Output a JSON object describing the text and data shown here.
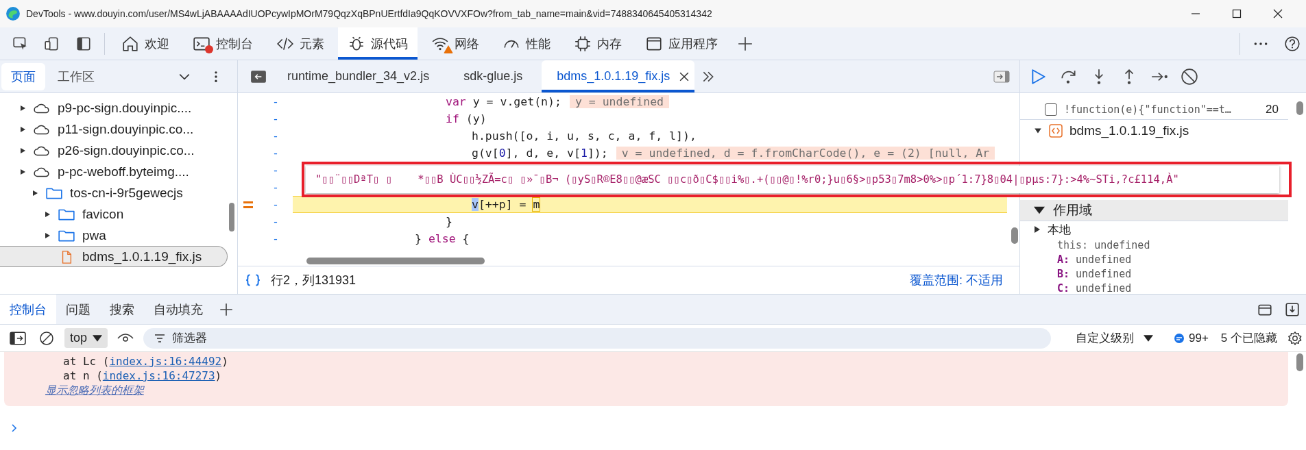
{
  "window": {
    "title": "DevTools - www.douyin.com/user/MS4wLjABAAAAdIUOPcywIpMOrM79QqzXqBPnUErtfdIa9QqKOVVXFOw?from_tab_name=main&vid=7488340645405314342"
  },
  "panel_tabs": [
    {
      "label": "欢迎",
      "selected": false,
      "error_badge": false,
      "warning_badge": false
    },
    {
      "label": "控制台",
      "selected": false,
      "error_badge": true,
      "warning_badge": false
    },
    {
      "label": "元素",
      "selected": false,
      "error_badge": false,
      "warning_badge": false
    },
    {
      "label": "源代码",
      "selected": true,
      "error_badge": false,
      "warning_badge": false
    },
    {
      "label": "网络",
      "selected": false,
      "error_badge": false,
      "warning_badge": true
    },
    {
      "label": "性能",
      "selected": false,
      "error_badge": false,
      "warning_badge": false
    },
    {
      "label": "内存",
      "selected": false,
      "error_badge": false,
      "warning_badge": false
    },
    {
      "label": "应用程序",
      "selected": false,
      "error_badge": false,
      "warning_badge": false
    }
  ],
  "navigator": {
    "tabs": [
      {
        "label": "页面",
        "selected": true
      },
      {
        "label": "工作区",
        "selected": false
      }
    ],
    "tree": [
      {
        "label": "p9-pc-sign.douyinpic....",
        "kind": "domain",
        "selected": false
      },
      {
        "label": "p11-sign.douyinpic.co...",
        "kind": "domain",
        "selected": false
      },
      {
        "label": "p26-sign.douyinpic.co...",
        "kind": "domain",
        "selected": false
      },
      {
        "label": "p-pc-weboff.byteimg....",
        "kind": "domain",
        "selected": false,
        "children": [
          {
            "label": "tos-cn-i-9r5gewecjs",
            "kind": "folder",
            "selected": false,
            "children": [
              {
                "label": "favicon",
                "kind": "folder",
                "selected": false
              },
              {
                "label": "pwa",
                "kind": "folder",
                "selected": false
              },
              {
                "label": "bdms_1.0.1.19_fix.js",
                "kind": "file",
                "selected": true
              }
            ]
          }
        ]
      }
    ]
  },
  "editor": {
    "tabs": [
      {
        "label": "runtime_bundler_34_v2.js",
        "selected": false,
        "closable": false
      },
      {
        "label": "sdk-glue.js",
        "selected": false,
        "closable": false
      },
      {
        "label": "bdms_1.0.1.19_fix.js",
        "selected": true,
        "closable": true
      }
    ],
    "lines": [
      {
        "gutter": "-",
        "current": false,
        "outdent": false,
        "segments": [
          {
            "text": "var",
            "kind": "keyword"
          },
          {
            "text": " y = v.get(n);",
            "kind": "plain"
          }
        ],
        "inline_value": "y = undefined"
      },
      {
        "gutter": "-",
        "current": false,
        "outdent": false,
        "segments": [
          {
            "text": "if",
            "kind": "keyword"
          },
          {
            "text": " (y)",
            "kind": "plain"
          }
        ],
        "children": [
          {
            "gutter": "-",
            "current": false,
            "outdent": false,
            "segments": [
              {
                "text": "h.push([o, i, u, s, c, a, f, l]),",
                "kind": "plain"
              }
            ]
          },
          {
            "gutter": "-",
            "current": false,
            "outdent": false,
            "segments": [
              {
                "text": "g(v[",
                "kind": "plain"
              },
              {
                "text": "0",
                "kind": "number"
              },
              {
                "text": "], d, e, v[",
                "kind": "plain"
              },
              {
                "text": "1",
                "kind": "number"
              },
              {
                "text": "]);",
                "kind": "plain"
              }
            ],
            "inline_value": "v = undefined, d = f.fromCharCode(), e = (2) [null, Ar"
          },
          {
            "gutter": "-",
            "current": false
          },
          {
            "gutter": "-",
            "current": false
          },
          {
            "gutter": "-",
            "current": true,
            "outdent": false,
            "segments": [
              {
                "text": "v",
                "kind": "selection"
              },
              {
                "text": "[++p] = ",
                "kind": "plain"
              },
              {
                "text": "m",
                "kind": "cursor"
              }
            ]
          }
        ]
      },
      {
        "gutter": "-",
        "current": false,
        "outdent": false,
        "segments": [
          {
            "text": "}",
            "kind": "plain"
          }
        ]
      },
      {
        "gutter": "-",
        "current": false,
        "outdent": true,
        "segments": [
          {
            "text": "} ",
            "kind": "plain"
          },
          {
            "text": "else",
            "kind": "keyword"
          },
          {
            "text": " {",
            "kind": "plain"
          }
        ]
      }
    ],
    "tooltip": "\"▯▯¨▯▯DªT▯ ▯    *▯▯B ÙC▯▯½ZÃ=c▯ ▯»¯▯B¬ (▯yS▯R®E8▯▯@æSC ▯▯c▯ð▯C$▯▯i%▯.+(▯▯@▯!%r0;}u▯6§>▯p53▯7m8>0%>▯p´1:7}8▯04|▯pµs:7}:>4%~STi,?c£114,À\"",
    "position": "行2，列131931",
    "coverage": "覆盖范围: 不适用"
  },
  "debugger": {
    "breakpoints": [
      {
        "code": "!function(e){\"function\"==t…",
        "line": "20",
        "checked": false
      }
    ],
    "file": "bdms_1.0.1.19_fix.js",
    "scope": {
      "title": "作用域",
      "group": "本地",
      "variables": [
        {
          "name": "this:",
          "value": "undefined",
          "kind": "this"
        },
        {
          "name": "A:",
          "value": "undefined",
          "kind": "var"
        },
        {
          "name": "B:",
          "value": "undefined",
          "kind": "var"
        },
        {
          "name": "C:",
          "value": "undefined",
          "kind": "var"
        }
      ]
    }
  },
  "drawer": {
    "tabs": [
      {
        "label": "控制台",
        "selected": true
      },
      {
        "label": "问题",
        "selected": false
      },
      {
        "label": "搜索",
        "selected": false
      },
      {
        "label": "自动填充",
        "selected": false
      }
    ],
    "context": "top",
    "filter_placeholder": "筛选器",
    "levels": "自定义级别",
    "issues": "99+",
    "hidden": "5 个已隐藏",
    "stack": [
      {
        "text": "at Lc (",
        "link": "index.js:16:44492",
        "end": ")"
      },
      {
        "text": "at n (",
        "link": "index.js:16:47273",
        "end": ")"
      }
    ],
    "ignore_link": "显示忽略列表的框架"
  }
}
